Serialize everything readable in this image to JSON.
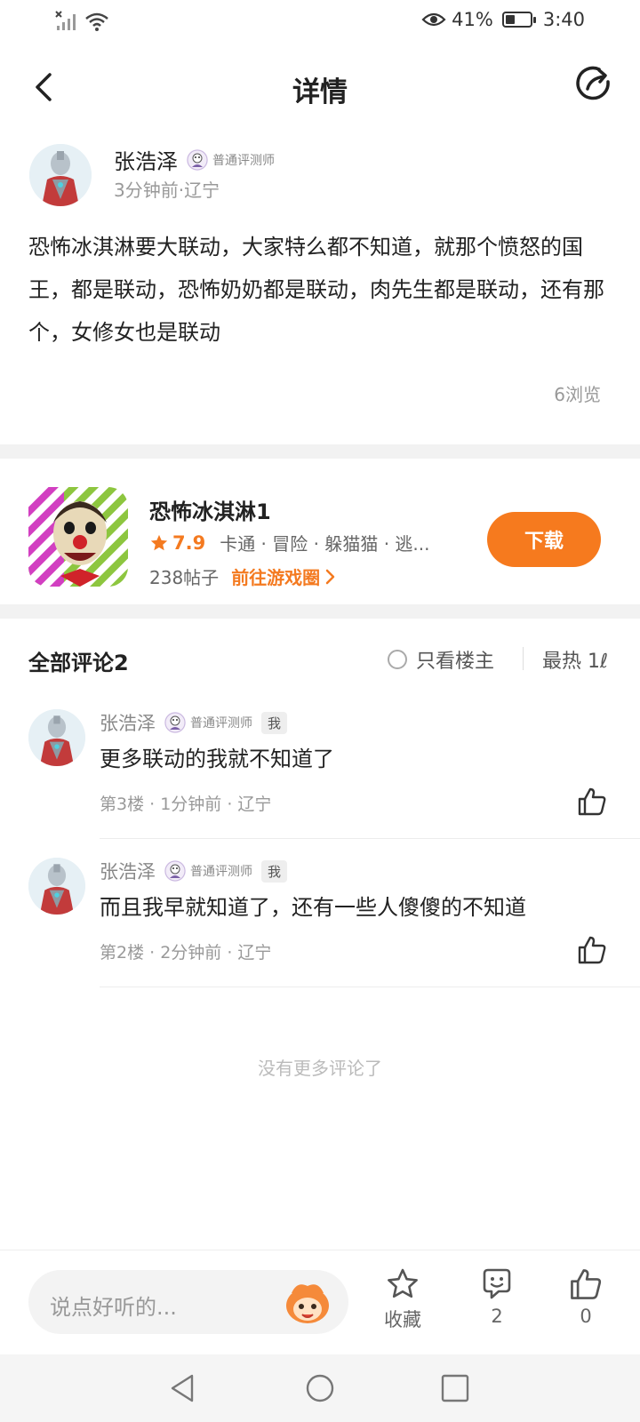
{
  "status_bar": {
    "battery_percent": "41%",
    "battery_level": 0.41,
    "time": "3:40",
    "icons": [
      "no-signal-icon",
      "wifi-icon",
      "eye-icon",
      "battery-icon"
    ]
  },
  "header": {
    "title": "详情",
    "back_icon": "back-arrow-icon",
    "share_icon": "share-icon"
  },
  "post": {
    "author": "张浩泽",
    "badge": "普通评测师",
    "meta": "3分钟前·辽宁",
    "body": "恐怖冰淇淋要大联动，大家特么都不知道，就那个愤怒的国王，都是联动，恐怖奶奶都是联动，肉先生都是联动，还有那个，女修女也是联动",
    "views": "6浏览"
  },
  "game": {
    "title": "恐怖冰淇淋1",
    "rating": "7.9",
    "tags": "卡通 · 冒险 · 躲猫猫 · 逃...",
    "posts": "238帖子",
    "goto_label": "前往游戏圈",
    "download_label": "下载"
  },
  "comments": {
    "title": "全部评论2",
    "only_op_label": "只看楼主",
    "sort_label": "最热  1ℓ",
    "items": [
      {
        "author": "张浩泽",
        "badge": "普通评测师",
        "me_tag": "我",
        "text": "更多联动的我就不知道了",
        "meta": "第3楼 · 1分钟前 · 辽宁"
      },
      {
        "author": "张浩泽",
        "badge": "普通评测师",
        "me_tag": "我",
        "text": "而且我早就知道了，还有一些人傻傻的不知道",
        "meta": "第2楼 · 2分钟前 · 辽宁"
      }
    ],
    "no_more": "没有更多评论了"
  },
  "bottom_bar": {
    "input_placeholder": "说点好听的...",
    "favorite_label": "收藏",
    "comment_count": "2",
    "like_count": "0"
  },
  "colors": {
    "accent": "#f67a1e",
    "text_primary": "#222222",
    "text_secondary": "#999999"
  }
}
